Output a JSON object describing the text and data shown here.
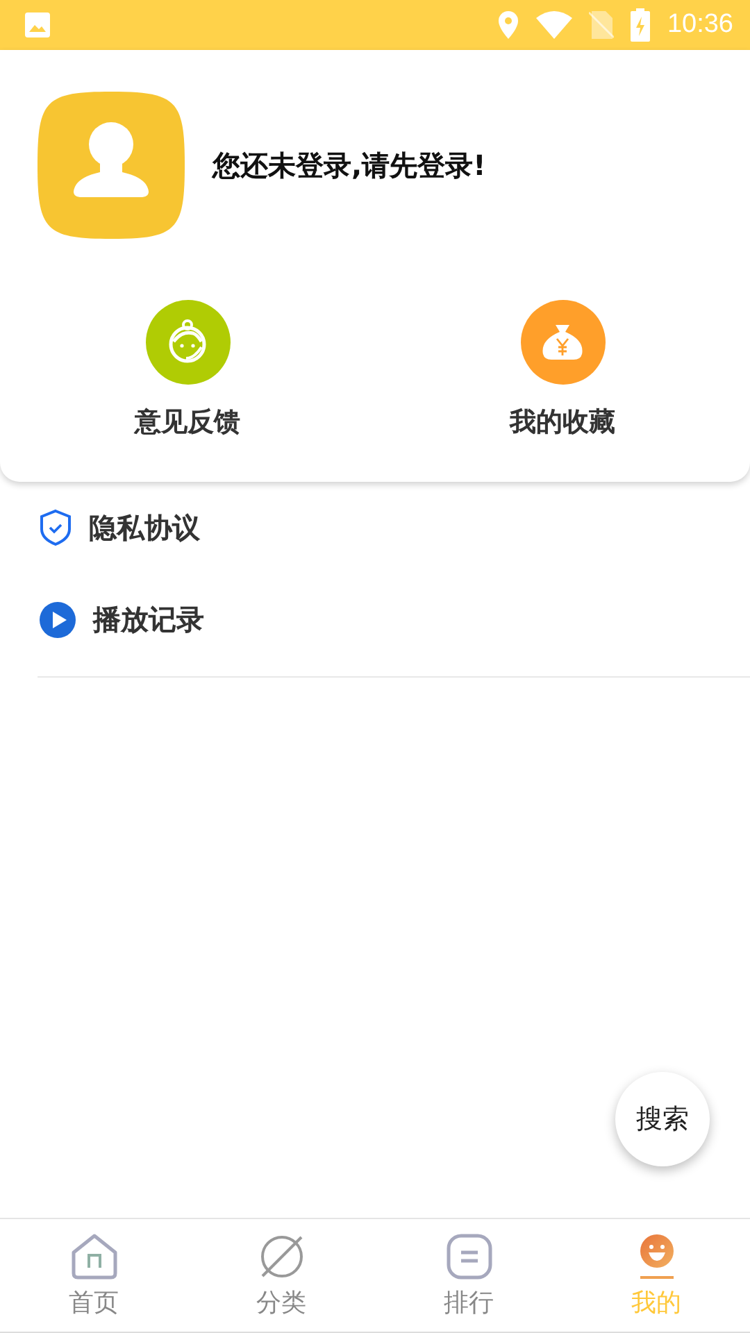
{
  "status_bar": {
    "time": "10:36"
  },
  "profile": {
    "login_prompt": "您还未登录,请先登录!"
  },
  "actions": [
    {
      "kind": "feedback",
      "label": "意见反馈",
      "color": "#b0cc04"
    },
    {
      "kind": "favorites",
      "label": "我的收藏",
      "color": "#ff9f2a"
    }
  ],
  "menu": [
    {
      "kind": "privacy",
      "label": "隐私协议"
    },
    {
      "kind": "history",
      "label": "播放记录"
    }
  ],
  "search_button": {
    "label": "搜索"
  },
  "tabs": [
    {
      "kind": "home",
      "label": "首页",
      "selected": false
    },
    {
      "kind": "category",
      "label": "分类",
      "selected": false
    },
    {
      "kind": "ranking",
      "label": "排行",
      "selected": false
    },
    {
      "kind": "mine",
      "label": "我的",
      "selected": true
    }
  ]
}
